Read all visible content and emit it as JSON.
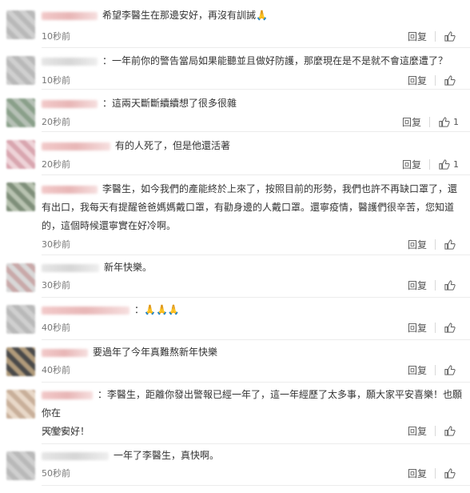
{
  "comments": [
    {
      "text": "希望李醫生在那邊安好，再沒有訓誡🙏",
      "time": "10秒前",
      "reply": "回复",
      "likes": ""
    },
    {
      "text": "：一年前你的警告當局如果能聽並且做好防護，那麼現在是不是就不會這麼遭了？",
      "time": "10秒前",
      "reply": "回复",
      "likes": ""
    },
    {
      "text": "：這兩天斷斷續續想了很多很雜",
      "time": "20秒前",
      "reply": "回复",
      "likes": "1"
    },
    {
      "text": "有的人死了，但是他還活著",
      "time": "20秒前",
      "reply": "回复",
      "likes": "1"
    },
    {
      "text_lines": [
        "李醫生，如今我們的產能終於上來了，按照目前的形勢，我們也許不再缺口罩了，還",
        "有出口，我每天有提醒爸爸媽媽戴口罩，有勸身邊的人戴口罩。還寧疫情，醫護們很辛苦，您知道",
        "的，這個時候還寧實在好冷啊。"
      ],
      "time": "30秒前",
      "reply": "回复",
      "likes": ""
    },
    {
      "text": "新年快樂。",
      "time": "30秒前",
      "reply": "回复",
      "likes": ""
    },
    {
      "text": "：🙏🙏🙏",
      "time": "40秒前",
      "reply": "回复",
      "likes": ""
    },
    {
      "text": "要過年了今年真難熬新年快樂",
      "time": "40秒前",
      "reply": "回复",
      "likes": ""
    },
    {
      "text_lines": [
        "：李醫生，距離你發出警報已經一年了，這一年經歷了太多事，願大家平安喜樂！也願你在",
        "天堂安好！"
      ],
      "time": "50秒前",
      "reply": "回复",
      "likes": ""
    },
    {
      "text": "一年了李醫生，真快啊。",
      "time": "50秒前",
      "reply": "回复",
      "likes": ""
    }
  ],
  "icons": {
    "like": "thumbs-up-icon"
  }
}
